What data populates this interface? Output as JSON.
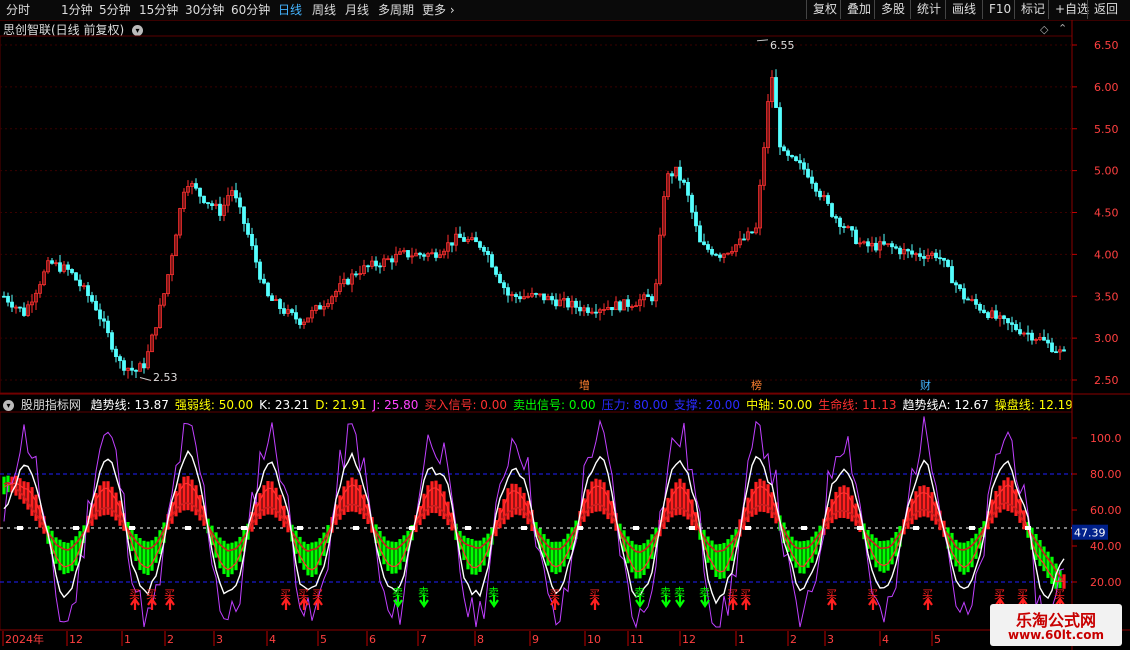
{
  "toolbar": {
    "periods": [
      "分时",
      "1分钟",
      "5分钟",
      "15分钟",
      "30分钟",
      "60分钟",
      "日线",
      "周线",
      "月线",
      "多周期",
      "更多"
    ],
    "active_period": "日线",
    "right_buttons": [
      "复权",
      "叠加",
      "多股",
      "统计",
      "画线",
      "F10",
      "标记",
      "+自选",
      "返回"
    ]
  },
  "main_panel": {
    "title": "思创智联(日线 前复权)",
    "high_marker": "6.55",
    "low_marker": "2.53",
    "event_tags": [
      "增",
      "榜",
      "财"
    ],
    "price_axis": [
      "6.50",
      "6.00",
      "5.50",
      "5.00",
      "4.50",
      "4.00",
      "3.50",
      "3.00",
      "2.50"
    ]
  },
  "indicator_panel": {
    "name": "股朋指标网",
    "legend": [
      {
        "label": "趋势线:",
        "value": "13.87",
        "color": "#ffffff"
      },
      {
        "label": "强弱线:",
        "value": "50.00",
        "color": "#ffff00"
      },
      {
        "label": "K:",
        "value": "23.21",
        "color": "#ffffff"
      },
      {
        "label": "D:",
        "value": "21.91",
        "color": "#ffff00"
      },
      {
        "label": "J:",
        "value": "25.80",
        "color": "#ff44ff"
      },
      {
        "label": "买入信号:",
        "value": "0.00",
        "color": "#ff3030"
      },
      {
        "label": "卖出信号:",
        "value": "0.00",
        "color": "#00ff00"
      },
      {
        "label": "压力:",
        "value": "80.00",
        "color": "#2a2aff"
      },
      {
        "label": "支撑:",
        "value": "20.00",
        "color": "#2a2aff"
      },
      {
        "label": "中轴:",
        "value": "50.00",
        "color": "#ffff00"
      },
      {
        "label": "生命线:",
        "value": "11.13",
        "color": "#ff3030"
      },
      {
        "label": "趋势线A:",
        "value": "12.67",
        "color": "#ffffff"
      },
      {
        "label": "操盘线:",
        "value": "12.19",
        "color": "#ffff00"
      }
    ],
    "axis": [
      "100.0",
      "80.00",
      "60.00",
      "40.00",
      "20.00"
    ],
    "current_value": "47.39",
    "buy_label": "买",
    "sell_label": "卖"
  },
  "time_axis": [
    "2024年",
    "12",
    "1",
    "2",
    "3",
    "4",
    "5",
    "6",
    "7",
    "8",
    "9",
    "10",
    "11",
    "12",
    "1",
    "2",
    "3",
    "4",
    "5"
  ],
  "watermark": {
    "title": "乐淘公式网",
    "url": "www.60lt.com"
  },
  "colors": {
    "up": "#ff3030",
    "down": "#54ffff",
    "buy": "#ff2020",
    "sell": "#00ff00",
    "grid": "#5a0000"
  }
}
